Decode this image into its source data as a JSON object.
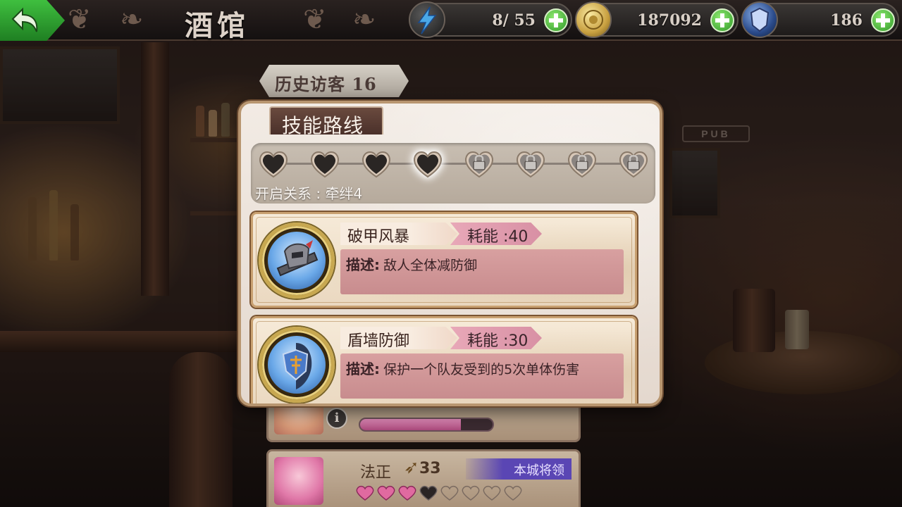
{
  "header": {
    "back_label": "",
    "title": "酒馆",
    "resources": [
      {
        "icon": "lightning-icon",
        "value": "8/ 55"
      },
      {
        "icon": "gold-coin-icon",
        "value": "187092"
      },
      {
        "icon": "crest-icon",
        "value": "186"
      }
    ]
  },
  "list": {
    "visitor_tag": "历史访客 16",
    "hero": {
      "name": "法正",
      "level": "33",
      "tag": "本城将领"
    },
    "previous_hero_hp_fraction": 0.76
  },
  "panel": {
    "title": "技能路线",
    "route": {
      "total_nodes": 8,
      "unlocked_nodes": 4,
      "current_node": 4,
      "relation_text": "开启关系 : 牵绊4"
    },
    "skills": [
      {
        "name": "破甲风暴",
        "cost": "耗能 :40",
        "desc_label": "描述:",
        "desc_text": "敌人全体减防御",
        "icon": "armor-break-icon"
      },
      {
        "name": "盾墙防御",
        "cost": "耗能 :30",
        "desc_label": "描述:",
        "desc_text": "保护一个队友受到的5次单体伤害",
        "icon": "shield-wall-icon"
      }
    ]
  },
  "colors": {
    "accent_green": "#2f9a28",
    "panel_border": "#b89670",
    "desc_bg": "#c88c8e",
    "cost_bg": "#d890a4",
    "tag_purple": "#5a46b4"
  }
}
